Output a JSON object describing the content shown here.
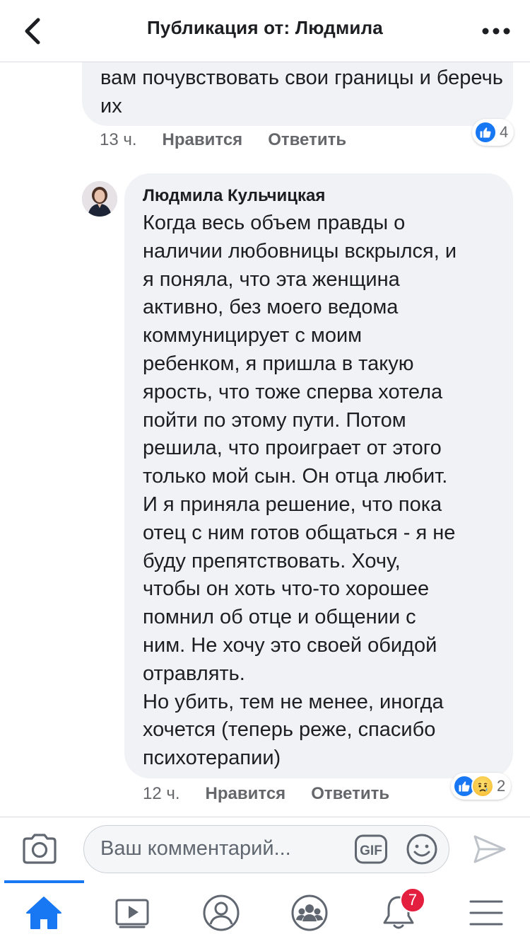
{
  "header": {
    "title": "Публикация от: Людмила"
  },
  "comments": [
    {
      "text": "вам почувствовать свои границы и беречь их",
      "time": "13 ч.",
      "like_label": "Нравится",
      "reply_label": "Ответить",
      "reactions": [
        "like"
      ],
      "reaction_count": "4"
    },
    {
      "author": "Людмила Кульчицкая",
      "text": "Когда весь объем правды о\nналичии любовницы вскрылся, и\nя поняла, что эта женщина\nактивно, без моего ведома\nкоммуницирует с моим\nребенком, я пришла в такую\nярость, что тоже сперва хотела\nпойти по этому пути. Потом\nрешила, что проиграет от этого\nтолько мой сын. Он отца любит.\nИ я приняла решение, что  пока\nотец с ним готов общаться - я не\nбуду препятствовать. Хочу,\nчтобы он хоть что-то хорошее\nпомнил об отце и общении с\nним. Не хочу это своей обидой\nотравлять.\nНо убить, тем не менее, иногда\nхочется (теперь реже, спасибо\nпсихотерапии)",
      "time": "12 ч.",
      "like_label": "Нравится",
      "reply_label": "Ответить",
      "reactions": [
        "like",
        "sad"
      ],
      "reaction_count": "2"
    }
  ],
  "composer": {
    "placeholder": "Ваш комментарий...",
    "gif_label": "GIF",
    "icons": [
      "camera-icon",
      "gif-icon",
      "emoji-icon",
      "send-icon"
    ]
  },
  "tabbar": {
    "tabs": [
      "home",
      "watch",
      "profile",
      "groups",
      "notifications",
      "menu"
    ],
    "active": "home",
    "notifications_badge": "7"
  },
  "colors": {
    "accent": "#1877f2",
    "bubble": "#f0f2f5",
    "meta_text": "#65676b",
    "icon_gray": "#606770",
    "badge_red": "#e41e3f"
  }
}
